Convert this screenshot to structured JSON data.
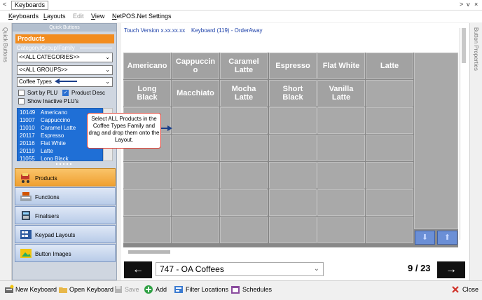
{
  "titlebar": {
    "back": "<",
    "tab": "Keyboards",
    "chev_right": ">",
    "chev_down": "v",
    "close": "×"
  },
  "menu": {
    "items": [
      "Keyboards",
      "Layouts",
      "Edit",
      "View",
      "NetPOS.Net Settings"
    ]
  },
  "side": {
    "left": "Quick Buttons",
    "right": "Button Properties"
  },
  "quick_buttons": {
    "header": "Quick Buttons",
    "section": "Products",
    "filter_label": "Category/Group/Family",
    "category_select": "<<ALL CATEGORIES>>",
    "group_select": "<<ALL GROUPS>>",
    "family_select": "Coffee Types",
    "sort_by_plu": "Sort by PLU",
    "product_desc": "Product Desc",
    "show_inactive": "Show Inactive PLU's",
    "products": [
      {
        "code": "10149",
        "name": "Americano"
      },
      {
        "code": "11007",
        "name": "Cappuccino"
      },
      {
        "code": "11010",
        "name": "Caramel Latte"
      },
      {
        "code": "20117",
        "name": "Espresso"
      },
      {
        "code": "20116",
        "name": "Flat White"
      },
      {
        "code": "20119",
        "name": "Latte"
      },
      {
        "code": "11055",
        "name": "Long Black"
      }
    ]
  },
  "nav": [
    "Products",
    "Functions",
    "Finalisers",
    "Keypad Layouts",
    "Button Images"
  ],
  "main": {
    "version": "Touch Version x.xx.xx.xx",
    "keyboard": "Keyboard (119) - OrderAway",
    "row1": [
      "Americano",
      "Cappuccin\no",
      "Caramel\nLatte",
      "Espresso",
      "Flat White",
      "Latte"
    ],
    "row2": [
      "Long\nBlack",
      "Macchiato",
      "Mocha\nLatte",
      "Short\nBlack",
      "Vanilla\nLatte"
    ]
  },
  "callout": "Select ALL Products in the Coffee Types Family and drag and drop them onto the Layout.",
  "bottom": {
    "prev": "←",
    "layout": "747 - OA Coffees",
    "page": "9 / 23",
    "next": "→"
  },
  "status": {
    "new_keyboard": "New Keyboard",
    "open_keyboard": "Open Keyboard",
    "save": "Save",
    "add": "Add",
    "filter_locations": "Filter Locations",
    "schedules": "Schedules",
    "close": "Close"
  },
  "colors": {
    "accent": "#f28c1e",
    "selection": "#1f6fd6",
    "grid_cell": "#a2a2a2",
    "callout_border": "#e0463b"
  }
}
